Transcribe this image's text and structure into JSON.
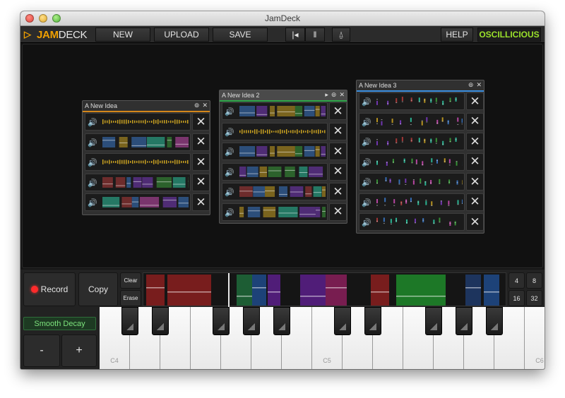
{
  "window": {
    "title": "JamDeck"
  },
  "toolbar": {
    "logo_jam": "JAM",
    "logo_deck": "DECK",
    "new_label": "NEW",
    "upload_label": "UPLOAD",
    "save_label": "SAVE",
    "rewind_icon": "|◂",
    "pause_icon": "ǁ",
    "metronome_icon": "⍙",
    "help_label": "HELP",
    "brand": "OSCILLICIOUS"
  },
  "panels": [
    {
      "title": "A New Idea",
      "accent": "#d4861a",
      "tracks": 5
    },
    {
      "title": "A New Idea 2",
      "accent": "#2fa84a",
      "tracks": 6
    },
    {
      "title": "A New Idea 3",
      "accent": "#3b8fe0",
      "tracks": 7
    }
  ],
  "controls": {
    "record_label": "Record",
    "copy_label": "Copy",
    "clear_label": "Clear",
    "erase_label": "Erase",
    "bar_4": "4",
    "bar_8": "8",
    "bar_16": "16",
    "bar_32": "32",
    "preset": "Smooth Decay",
    "minus": "-",
    "plus": "+"
  },
  "piano": {
    "white_labels": [
      "C4",
      "",
      "",
      "",
      "",
      "",
      "",
      "C5",
      "",
      "",
      "",
      "",
      "",
      "",
      "C6"
    ]
  },
  "colors": {
    "accent_orange": "#f0a000",
    "brand_green": "#9be22b",
    "record_red": "#ff2b2b"
  }
}
